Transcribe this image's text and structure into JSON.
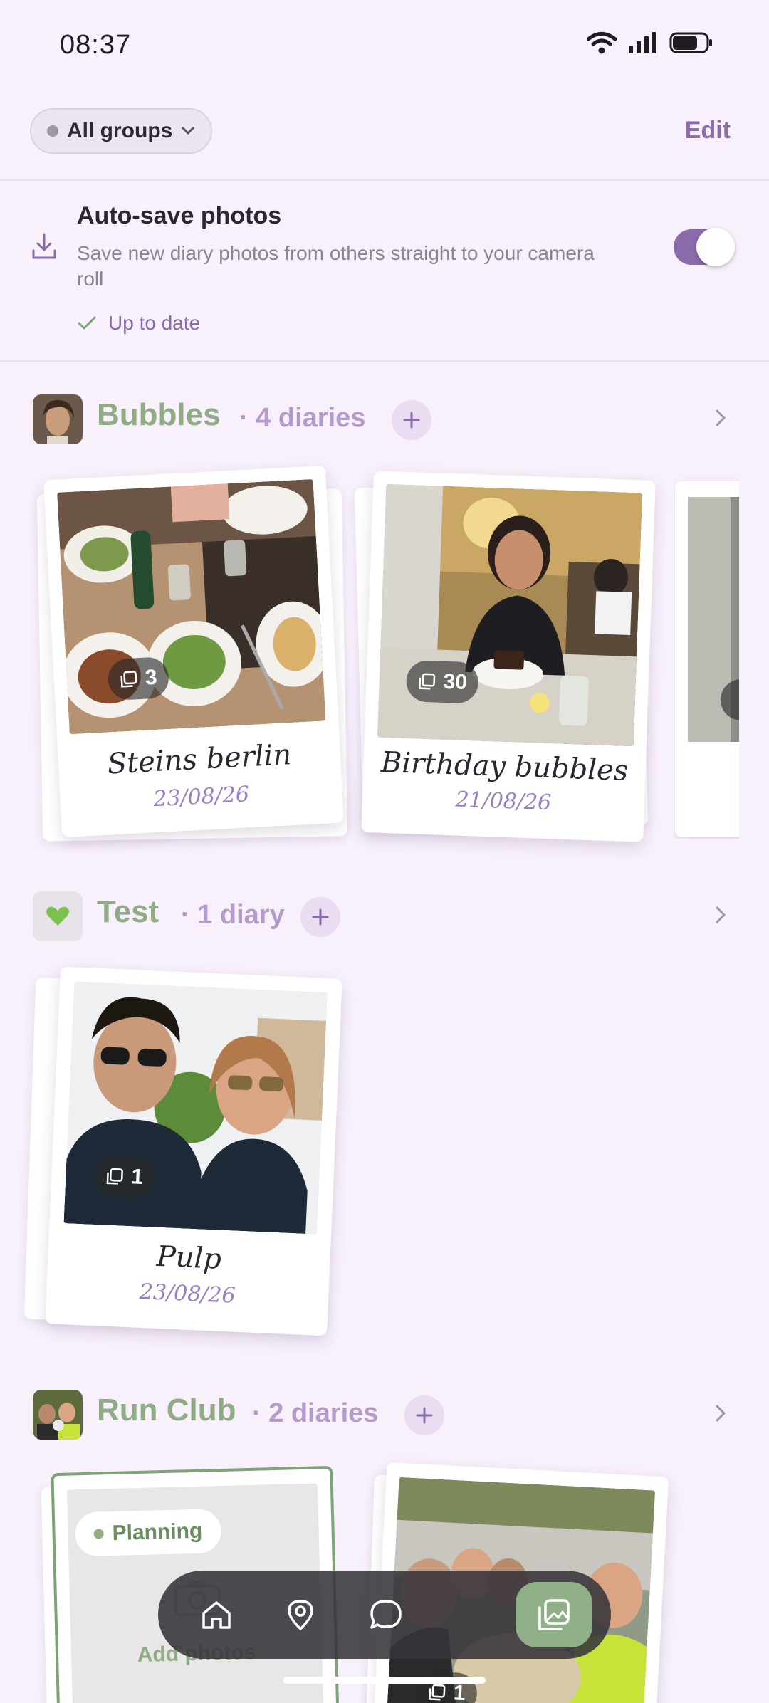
{
  "status": {
    "time": "08:37"
  },
  "header": {
    "group_filter": "All groups",
    "edit": "Edit"
  },
  "autosave": {
    "title": "Auto-save photos",
    "description": "Save new diary photos from others straight to your camera roll",
    "status": "Up to date",
    "enabled": true
  },
  "groups": [
    {
      "name": "Bubbles",
      "count": "· 4 diaries",
      "diaries": [
        {
          "title": "Steins berlin",
          "date": "23/08/26",
          "photos": "3"
        },
        {
          "title": "Birthday bubbles",
          "date": "21/08/26",
          "photos": "30"
        }
      ]
    },
    {
      "name": "Test",
      "count": "· 1 diary",
      "avatar_icon": "green-heart-icon",
      "diaries": [
        {
          "title": "Pulp",
          "date": "23/08/26",
          "photos": "1"
        }
      ]
    },
    {
      "name": "Run Club",
      "count": "· 2 diaries",
      "diaries": [
        {
          "status": "Planning",
          "add_label": "Add photos"
        },
        {
          "photos": "1"
        }
      ]
    }
  ],
  "nav": [
    "home-icon",
    "map-pin-icon",
    "chat-icon",
    "photos-icon"
  ],
  "colors": {
    "accent": "#8a6bab",
    "green": "#8fb086",
    "background": "#f8f0fb"
  }
}
